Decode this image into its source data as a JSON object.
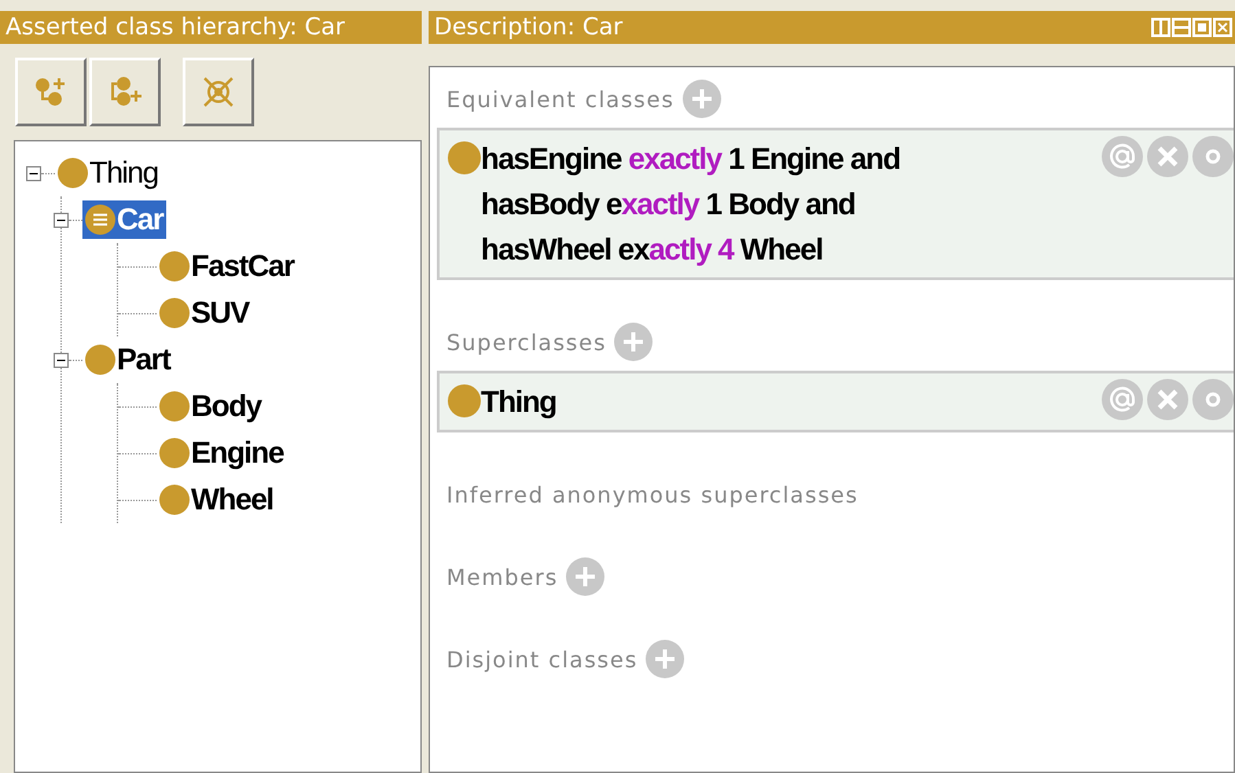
{
  "hierarchy_panel": {
    "title": "Asserted class hierarchy: Car",
    "tree": [
      {
        "label": "Thing",
        "defined": false,
        "selected": false,
        "expanded": true,
        "children": [
          {
            "label": "Car",
            "defined": true,
            "selected": true,
            "expanded": true,
            "children": [
              {
                "label": "FastCar",
                "defined": false,
                "selected": false
              },
              {
                "label": "SUV",
                "defined": false,
                "selected": false
              }
            ]
          },
          {
            "label": "Part",
            "defined": false,
            "selected": false,
            "expanded": true,
            "children": [
              {
                "label": "Body",
                "defined": false,
                "selected": false
              },
              {
                "label": "Engine",
                "defined": false,
                "selected": false
              },
              {
                "label": "Wheel",
                "defined": false,
                "selected": false
              }
            ]
          }
        ]
      }
    ]
  },
  "description_panel": {
    "title": "Description: Car",
    "sections": [
      {
        "title": "Equivalent classes",
        "add_button": true,
        "items": [
          {
            "lines": [
              [
                {
                  "kind": "name",
                  "text": "hasEngine "
                },
                {
                  "kind": "keyword",
                  "text": "exactly"
                },
                {
                  "kind": "name",
                  "text": " 1 Engine and"
                }
              ],
              [
                {
                  "kind": "name",
                  "text": "hasBody e"
                },
                {
                  "kind": "keyword",
                  "text": "xactly"
                },
                {
                  "kind": "name",
                  "text": " 1 Body and"
                }
              ],
              [
                {
                  "kind": "name",
                  "text": "hasWheel ex"
                },
                {
                  "kind": "keyword",
                  "text": "actly 4"
                },
                {
                  "kind": "name",
                  "text": " Wheel"
                }
              ]
            ]
          }
        ]
      },
      {
        "title": "Superclasses",
        "add_button": true,
        "items": [
          {
            "lines": [
              [
                {
                  "kind": "name",
                  "text": "Thing"
                }
              ]
            ]
          }
        ]
      },
      {
        "title": "Inferred anonymous superclasses",
        "add_button": false
      },
      {
        "title": "Members",
        "add_button": true
      },
      {
        "title": "Disjoint classes",
        "add_button": true
      }
    ]
  }
}
